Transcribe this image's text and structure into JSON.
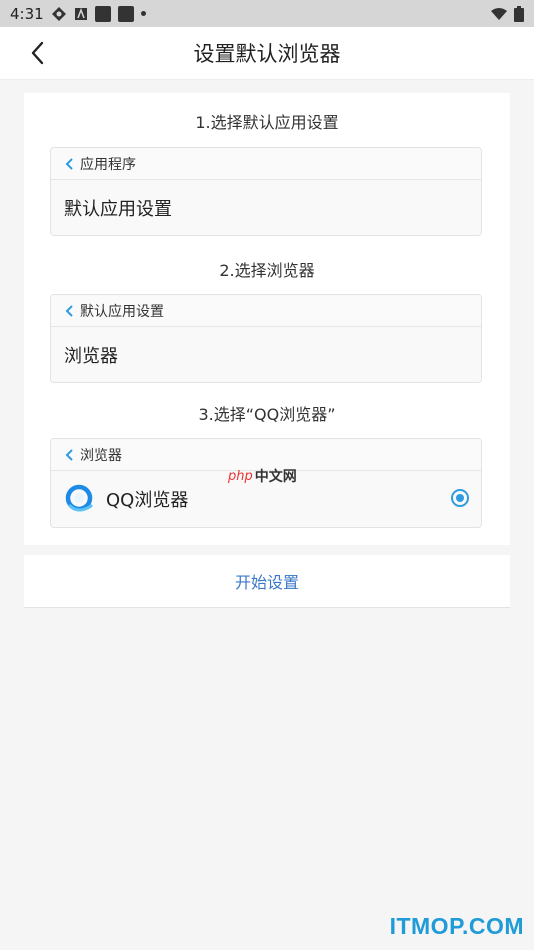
{
  "status_bar": {
    "time": "4:31"
  },
  "header": {
    "title": "设置默认浏览器"
  },
  "steps": [
    {
      "title": "1.选择默认应用设置",
      "crumb": "应用程序",
      "row": "默认应用设置"
    },
    {
      "title": "2.选择浏览器",
      "crumb": "默认应用设置",
      "row": "浏览器"
    },
    {
      "title": "3.选择“QQ浏览器”",
      "crumb": "浏览器",
      "row": "QQ浏览器",
      "icon": "qq-browser-icon",
      "selected": true
    }
  ],
  "watermark": {
    "php": "php",
    "cn": "中文网"
  },
  "start_button": {
    "label": "开始设置"
  },
  "site_mark": "ITMOP.COM",
  "colors": {
    "accent": "#2f9be0",
    "link": "#3a78c8",
    "brand": "#1f9bd8"
  }
}
